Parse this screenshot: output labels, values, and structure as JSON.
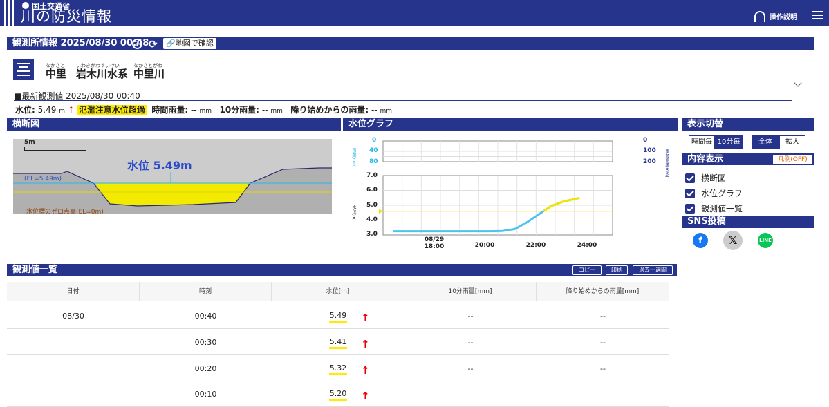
{
  "header": {
    "ministry": "国土交通省",
    "title": "川の防災情報",
    "help_label": "操作説明"
  },
  "station": {
    "panel_title": "観測所情報 2025/08/30 00:48",
    "map_button": "地図で確認",
    "name": "中里",
    "name_ruby": "なかさと",
    "system": "岩木川水系",
    "system_ruby": "いわきがわすいけい",
    "river": "中里川",
    "river_ruby": "なかさとがわ",
    "latest_title": "■最新観測値  2025/08/30 00:40",
    "water_level_label": "水位:",
    "water_level_value": "5.49",
    "water_level_unit": "m",
    "water_level_arrow": "↑",
    "warning": "氾濫注意水位超過",
    "hourly_rain_label": "時間雨量:",
    "hourly_rain_value": "--",
    "rain_unit": "mm",
    "rain10_label": "10分雨量:",
    "rain10_value": "--",
    "cumulative_label": "降り始めからの雨量:",
    "cumulative_value": "--"
  },
  "cross_section": {
    "panel_title": "横断図",
    "scale_label": "5m",
    "water_level_label": "水位 5.49m",
    "el_label": "(EL=5.49m)",
    "zero_label": "水位標のゼロ点高(EL=0m)"
  },
  "graph": {
    "panel_title": "水位グラフ",
    "rain_ticks": [
      "0",
      "40",
      "80"
    ],
    "cum_ticks": [
      "0",
      "100",
      "200"
    ],
    "level_ticks": [
      "7.0",
      "6.0",
      "5.0",
      "4.0",
      "3.0"
    ],
    "x_labels": [
      "08/29\n18:00",
      "20:00",
      "22:00",
      "24:00"
    ],
    "rain_axis_label": "雨量[mm]",
    "cum_axis_label": "累加雨量[mm]",
    "level_axis_label": "水位[m]"
  },
  "chart_data": {
    "type": "line",
    "x": [
      "17:00",
      "18:00",
      "19:00",
      "20:00",
      "21:00",
      "21:30",
      "22:00",
      "22:30",
      "23:00",
      "23:30",
      "24:00",
      "00:40"
    ],
    "series": [
      {
        "values": [
          3.25,
          3.25,
          3.25,
          3.25,
          3.25,
          3.27,
          3.4,
          3.85,
          4.4,
          4.95,
          5.25,
          5.49
        ]
      }
    ],
    "ylim": [
      3.0,
      7.0
    ],
    "reference_line": 4.6
  },
  "display": {
    "panel_title": "表示切替",
    "interval_buttons": [
      "時間毎",
      "10分毎"
    ],
    "zoom_buttons": [
      "全体",
      "拡大"
    ],
    "content_title": "内容表示",
    "legend_button": "凡例(OFF)",
    "checks": [
      "横断図",
      "水位グラフ",
      "観測値一覧"
    ],
    "sns_title": "SNS投稿"
  },
  "list": {
    "panel_title": "観測値一覧",
    "buttons": [
      "コピー",
      "印刷",
      "過去一週間"
    ],
    "headers": [
      "日付",
      "時刻",
      "水位[m]",
      "10分雨量[mm]",
      "降り始めからの雨量[mm]"
    ],
    "rows": [
      {
        "date": "08/30",
        "time": "00:40",
        "level": "5.49",
        "arrow": "↑",
        "rain10": "--",
        "cum": "--"
      },
      {
        "date": "",
        "time": "00:30",
        "level": "5.41",
        "arrow": "↑",
        "rain10": "--",
        "cum": "--"
      },
      {
        "date": "",
        "time": "00:20",
        "level": "5.32",
        "arrow": "↑",
        "rain10": "--",
        "cum": "--"
      },
      {
        "date": "",
        "time": "00:10",
        "level": "5.20",
        "arrow": "↑",
        "rain10": "",
        "cum": ""
      }
    ]
  }
}
